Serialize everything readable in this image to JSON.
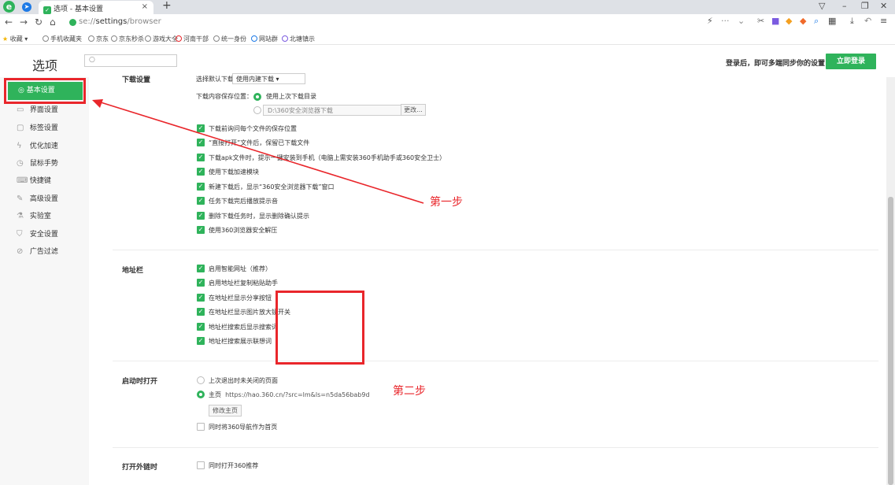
{
  "browser": {
    "logo_letter": "e",
    "tab_title": "选项 - 基本设置",
    "tab_close": "×",
    "new_tab": "+",
    "url_scheme": "se://",
    "url_host": "settings",
    "url_path": "/browser",
    "bookmarks": [
      "收藏",
      "手机收藏夹",
      "京东",
      "京东秒杀",
      "游戏大全",
      "河南干部",
      "统一身份",
      "网站群",
      "北塘镇示"
    ]
  },
  "header": {
    "title": "选项",
    "search_placeholder": "",
    "login_tip": "登录后，即可多端同步你的设置",
    "login_button": "立即登录"
  },
  "sidebar": {
    "active": "基本设置",
    "items": [
      "界面设置",
      "标签设置",
      "优化加速",
      "鼠标手势",
      "快捷键",
      "高级设置",
      "实验室",
      "安全设置",
      "广告过滤"
    ]
  },
  "download": {
    "section_title": "下载设置",
    "tool_label": "选择默认下载工具：",
    "tool_value": "使用内建下载 ▾",
    "location_label": "下载内容保存位置：",
    "option_last": "使用上次下载目录",
    "path_value": "D:\\360安全浏览器下载",
    "change_button": "更改...",
    "checks": [
      "下载前询问每个文件的保存位置",
      "“直接打开”文件后，保留已下载文件",
      "下载apk文件时，提示一键安装到手机（电脑上需安装360手机助手或360安全卫士）",
      "使用下载加速模块",
      "新建下载后，显示“360安全浏览器下载”窗口",
      "任务下载完后播放提示音",
      "删除下载任务时，显示删除确认提示",
      "使用360浏览器安全解压"
    ]
  },
  "addressbar": {
    "section_title": "地址栏",
    "checks": [
      "启用智能网址（推荐）",
      "启用地址栏复制粘贴助手",
      "在地址栏显示分享按钮",
      "在地址栏显示图片放大镜开关",
      "地址栏搜索后显示搜索词",
      "地址栏搜索展示联想词"
    ]
  },
  "startup": {
    "section_title": "启动时打开",
    "option_restore": "上次退出时未关闭的页面",
    "option_home": "主页",
    "home_url": "https://hao.360.cn/?src=lm&ls=n5da56bab9d",
    "modify_button": "修改主页",
    "nav_check": "同时将360导航作为首页"
  },
  "external": {
    "section_title": "打开外链时",
    "check": "同时打开360推荐"
  },
  "annotations": {
    "step1": "第一步",
    "step2": "第二步"
  },
  "colors": {
    "accent": "#2fb35b",
    "annotation": "#e9262b"
  }
}
